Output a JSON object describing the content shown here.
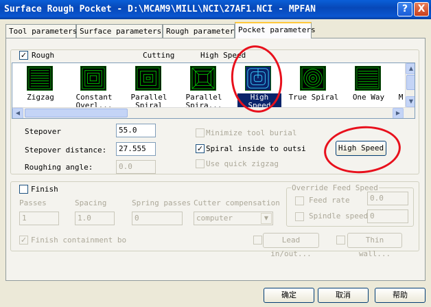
{
  "window": {
    "title": "Surface Rough Pocket - D:\\MCAM9\\MILL\\NCI\\27AF1.NCI - MPFAN",
    "help": "?",
    "close": "X"
  },
  "tabs": [
    "Tool parameters",
    "Surface parameters",
    "Rough parameters",
    "Pocket parameters"
  ],
  "rough": {
    "label": "Rough",
    "checked": "✓",
    "cutting_header": "Cutting",
    "high_speed_header": "High Speed"
  },
  "patterns": [
    {
      "line1": "Zigzag",
      "line2": "",
      "icon": "zigzag-icon"
    },
    {
      "line1": "Constant",
      "line2": "Overl...",
      "icon": "constant-overlap-icon"
    },
    {
      "line1": "Parallel",
      "line2": "Spiral",
      "icon": "parallel-spiral-icon"
    },
    {
      "line1": "Parallel",
      "line2": "Spira...",
      "icon": "parallel-spiral-clean-icon"
    },
    {
      "line1": "High Speed",
      "line2": "",
      "icon": "high-speed-icon",
      "selected": true
    },
    {
      "line1": "True Spiral",
      "line2": "",
      "icon": "true-spiral-icon"
    },
    {
      "line1": "One Way",
      "line2": "",
      "icon": "one-way-icon"
    },
    {
      "line1": "M",
      "line2": "",
      "icon": "morph-icon"
    }
  ],
  "fields": {
    "stepover_label": "Stepover",
    "stepover_value": "55.0",
    "stepover_distance_label": "Stepover distance:",
    "stepover_distance_value": "27.555",
    "roughing_angle_label": "Roughing angle:",
    "roughing_angle_value": "0.0"
  },
  "options": {
    "minimize_tool_burial": "Minimize tool burial",
    "spiral_inside": "Spiral inside to outsi",
    "spiral_checked": "✓",
    "use_quick_zigzag": "Use quick zigzag",
    "high_speed_button": "High Speed"
  },
  "finish": {
    "label": "Finish",
    "passes_label": "Passes",
    "passes_value": "1",
    "spacing_label": "Spacing",
    "spacing_value": "1.0",
    "spring_label": "Spring passes",
    "spring_value": "0",
    "cutter_comp_label": "Cutter compensation",
    "cutter_comp_value": "computer",
    "containment_label": "Finish containment boun",
    "containment_checked": "✓",
    "lead_button": "Lead in/out...",
    "thin_wall_button": "Thin wall..."
  },
  "override": {
    "title": "Override Feed Speed",
    "feed_rate_label": "Feed rate",
    "feed_rate_value": "0.0",
    "spindle_label": "Spindle speed",
    "spindle_value": "0"
  },
  "footer": {
    "ok": "确定",
    "cancel": "取消",
    "help": "帮助"
  },
  "colors": {
    "title_bar": "#0a55d0",
    "annotation": "#e8101c",
    "icon_green": "#00c000"
  }
}
